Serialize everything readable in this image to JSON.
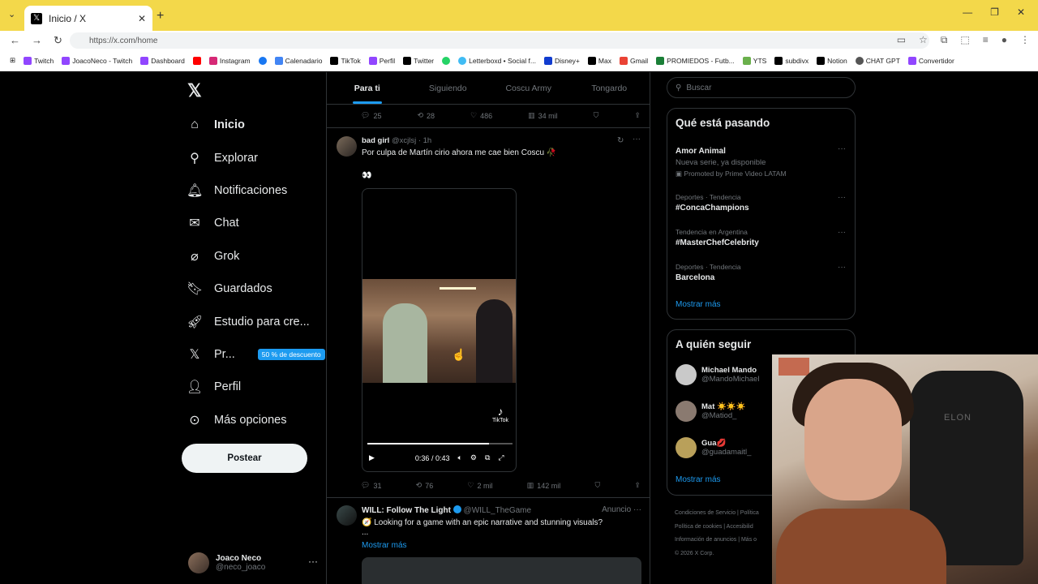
{
  "browser": {
    "tab_title": "Inicio / X",
    "url": "https://x.com/home",
    "bookmarks": [
      "Twitch",
      "JoacoNeco - Twitch",
      "Dashboard",
      "",
      "Instagram",
      "",
      "Calenadario",
      "TikTok",
      "Perfil",
      "Twitter",
      "",
      "Letterboxd • Social f...",
      "Disney+",
      "Max",
      "Gmail",
      "PROMIEDOS - Futb...",
      "YTS",
      "subdivx",
      "Notion",
      "CHAT GPT",
      "Convertidor"
    ]
  },
  "sidebar": {
    "items": [
      {
        "label": "Inicio",
        "icon": "home-icon"
      },
      {
        "label": "Explorar",
        "icon": "search-icon"
      },
      {
        "label": "Notificaciones",
        "icon": "bell-icon"
      },
      {
        "label": "Chat",
        "icon": "mail-icon"
      },
      {
        "label": "Grok",
        "icon": "grok-icon"
      },
      {
        "label": "Guardados",
        "icon": "bookmark-icon"
      },
      {
        "label": "Estudio para cre...",
        "icon": "rocket-icon"
      },
      {
        "label": "Pr...",
        "icon": "x-premium-icon"
      },
      {
        "label": "Perfil",
        "icon": "person-icon"
      },
      {
        "label": "Más opciones",
        "icon": "more-circle-icon"
      }
    ],
    "promo_badge": "50 % de descuento",
    "post_button": "Postear",
    "profile": {
      "name": "Joaco Neco",
      "handle": "@neco_joaco"
    }
  },
  "feed": {
    "tabs": [
      "Para ti",
      "Siguiendo",
      "Coscu Army",
      "Tongardo"
    ],
    "prev_actions": {
      "replies": "25",
      "reposts": "28",
      "likes": "486",
      "views": "34 mil"
    },
    "tweet": {
      "name": "bad girl",
      "handle": "@xcjlsj",
      "time": "· 1h",
      "text": "Por culpa de Martín cirio ahora me cae bien Coscu 🥀",
      "emoji": "👀",
      "video_time": "0:36 / 0:43",
      "video_progress": 0.84,
      "tiktok_label": "TikTok",
      "actions": {
        "replies": "31",
        "reposts": "76",
        "likes": "2 mil",
        "views": "142 mil"
      }
    },
    "ad": {
      "name": "WILL: Follow The Light",
      "handle": "@WILL_TheGame",
      "tag": "Anuncio",
      "text": "🧭 Looking for a game with an epic narrative and stunning visuals?",
      "ellipsis": "...",
      "more": "Mostrar más"
    }
  },
  "right": {
    "search_placeholder": "Buscar",
    "trends_title": "Qué está pasando",
    "trends": [
      {
        "meta": "",
        "title": "Amor Animal",
        "sub": "Nueva serie, ya disponible",
        "promo": "Promoted by Prime Video LATAM"
      },
      {
        "meta": "Deportes · Tendencia",
        "title": "#ConcaChampions"
      },
      {
        "meta": "Tendencia en Argentina",
        "title": "#MasterChefCelebrity"
      },
      {
        "meta": "Deportes · Tendencia",
        "title": "Barcelona"
      }
    ],
    "show_more": "Mostrar más",
    "follow_title": "A quién seguir",
    "follow": [
      {
        "name": "Michael Mando",
        "handle": "@MandoMichael"
      },
      {
        "name": "Mat ☀️☀️☀️",
        "handle": "@Matiod_"
      },
      {
        "name": "Gua💋",
        "handle": "@guadamaitl_"
      }
    ],
    "footer": [
      "Condiciones de Servicio | Política",
      "Política de cookies | Accesibilid",
      "Información de anuncios | Más o",
      "© 2026 X Corp."
    ]
  },
  "webcam": {
    "chair_text": "ELON"
  }
}
